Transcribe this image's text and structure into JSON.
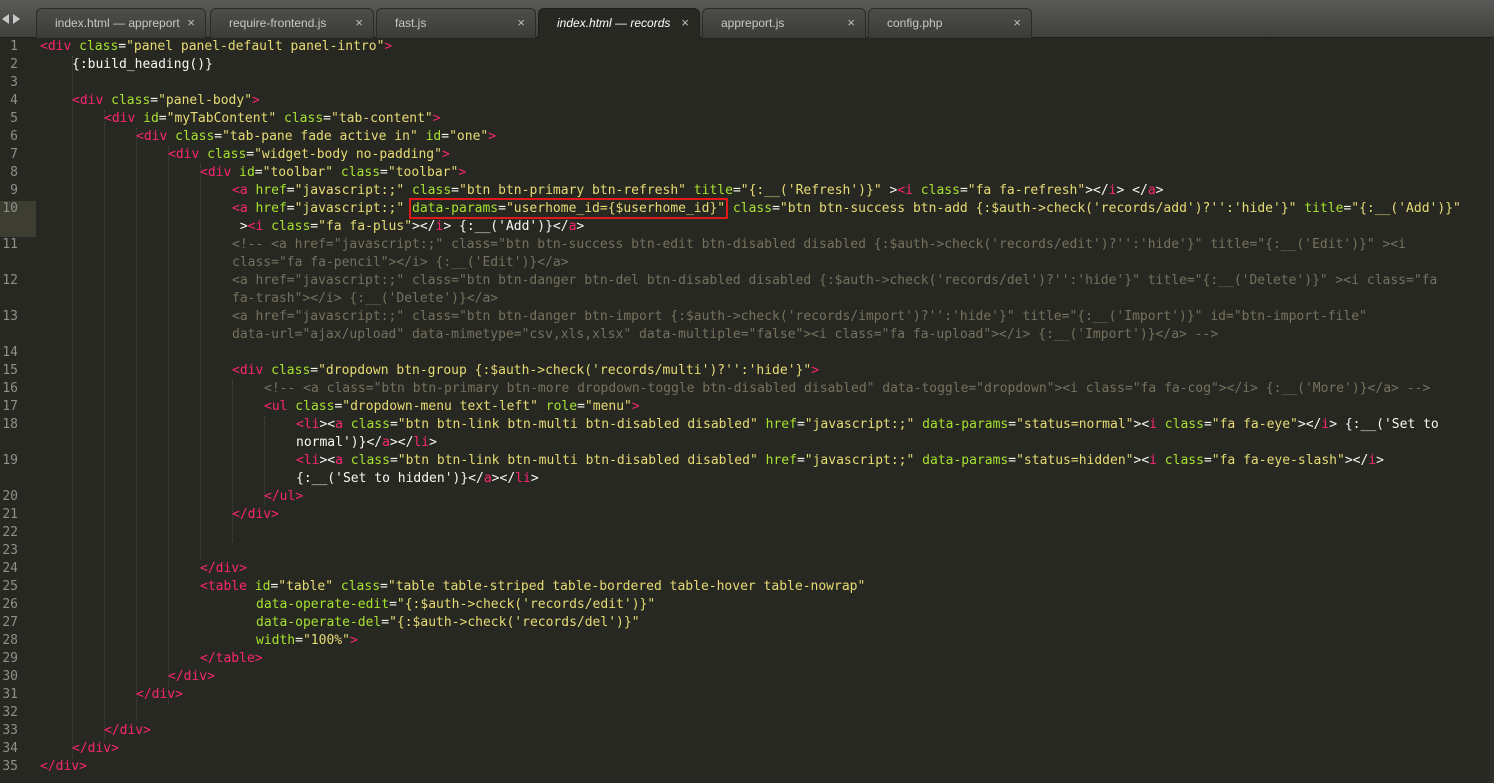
{
  "tabs": [
    {
      "label": "index.html — appreport",
      "active": false
    },
    {
      "label": "require-frontend.js",
      "active": false
    },
    {
      "label": "fast.js",
      "active": false
    },
    {
      "label": "index.html — records",
      "active": true
    },
    {
      "label": "appreport.js",
      "active": false
    },
    {
      "label": "config.php",
      "active": false
    }
  ],
  "tab_close_symbol": "×",
  "colors": {
    "background": "#272822",
    "tag": "#f92672",
    "attribute": "#a6e22e",
    "string": "#e6db74",
    "comment": "#75715e",
    "text": "#f8f8f2",
    "line_number": "#8f908a",
    "highlight_box": "#e0191b"
  },
  "highlighted_line": 10,
  "highlight_box_text": "data-params=\"userhome_id={$userhome_id}\"",
  "line_numbers": [
    "1",
    "2",
    "3",
    "4",
    "5",
    "6",
    "7",
    "8",
    "9",
    "10",
    "11",
    "12",
    "13",
    "14",
    "15",
    "16",
    "17",
    "18",
    "19",
    "20",
    "21",
    "22",
    "23",
    "24",
    "25",
    "26",
    "27",
    "28",
    "29",
    "30",
    "31",
    "32",
    "33",
    "34",
    "35"
  ],
  "code": {
    "l1": {
      "t1": "<div",
      "a1": " class",
      "p1": "=",
      "s1": "\"panel panel-default panel-intro\"",
      "t2": ">"
    },
    "l2": {
      "p1": "{:build_heading()}"
    },
    "l4": {
      "t1": "<div",
      "a1": " class",
      "p1": "=",
      "s1": "\"panel-body\"",
      "t2": ">"
    },
    "l5": {
      "t1": "<div",
      "a1": " id",
      "p1": "=",
      "s1": "\"myTabContent\"",
      "a2": " class",
      "p2": "=",
      "s2": "\"tab-content\"",
      "t2": ">"
    },
    "l6": {
      "t1": "<div",
      "a1": " class",
      "p1": "=",
      "s1": "\"tab-pane fade active in\"",
      "a2": " id",
      "p2": "=",
      "s2": "\"one\"",
      "t2": ">"
    },
    "l7": {
      "t1": "<div",
      "a1": " class",
      "p1": "=",
      "s1": "\"widget-body no-padding\"",
      "t2": ">"
    },
    "l8": {
      "t1": "<div",
      "a1": " id",
      "p1": "=",
      "s1": "\"toolbar\"",
      "a2": " class",
      "p2": "=",
      "s2": "\"toolbar\"",
      "t2": ">"
    },
    "l9": {
      "t1": "<a",
      "a1": " href",
      "p1": "=",
      "s1": "\"javascript:;\"",
      "a2": " class",
      "p2": "=",
      "s2": "\"btn btn-primary btn-refresh\"",
      "a3": " title",
      "p3": "=",
      "s3": "\"{:__('Refresh')}\"",
      "p4": " >",
      "t2": "<i",
      "a4": " class",
      "p5": "=",
      "s4": "\"fa fa-refresh\"",
      "p6": "></",
      "t3": "i",
      "p7": "> </",
      "t4": "a",
      "p8": ">"
    },
    "l10a": {
      "t1": "<a",
      "a1": " href",
      "p1": "=",
      "s1": "\"javascript:;\"",
      "sp": " ",
      "a2": "data-params",
      "p2": "=",
      "s2": "\"userhome_id={$userhome_id}\"",
      "a3": " class",
      "p3": "=",
      "s3": "\"btn btn-success btn-add {:$auth->check('records/add')?'':'hide'}\"",
      "a4": " title",
      "p4": "=",
      "s4": "\"{:__('Add')}\""
    },
    "l10b": {
      "p1": " >",
      "t1": "<i",
      "a1": " class",
      "p2": "=",
      "s1": "\"fa fa-plus\"",
      "p3": "></",
      "t2": "i",
      "p4": "> {:__('Add')}</",
      "t3": "a",
      "p5": ">"
    },
    "l11a": "<!-- <a href=\"javascript:;\" class=\"btn btn-success btn-edit btn-disabled disabled {:$auth->check('records/edit')?'':'hide'}\" title=\"{:__('Edit')}\" ><i",
    "l11b": "class=\"fa fa-pencil\"></i> {:__('Edit')}</a>",
    "l12a": "<a href=\"javascript:;\" class=\"btn btn-danger btn-del btn-disabled disabled {:$auth->check('records/del')?'':'hide'}\" title=\"{:__('Delete')}\" ><i class=\"fa",
    "l12b": "fa-trash\"></i> {:__('Delete')}</a>",
    "l13a": "<a href=\"javascript:;\" class=\"btn btn-danger btn-import {:$auth->check('records/import')?'':'hide'}\" title=\"{:__('Import')}\" id=\"btn-import-file\"",
    "l13b": "data-url=\"ajax/upload\" data-mimetype=\"csv,xls,xlsx\" data-multiple=\"false\"><i class=\"fa fa-upload\"></i> {:__('Import')}</a> -->",
    "l15": {
      "t1": "<div",
      "a1": " class",
      "p1": "=",
      "s1": "\"dropdown btn-group {:$auth->check('records/multi')?'':'hide'}\"",
      "t2": ">"
    },
    "l16": "<!-- <a class=\"btn btn-primary btn-more dropdown-toggle btn-disabled disabled\" data-toggle=\"dropdown\"><i class=\"fa fa-cog\"></i> {:__('More')}</a> -->",
    "l17": {
      "t1": "<ul",
      "a1": " class",
      "p1": "=",
      "s1": "\"dropdown-menu text-left\"",
      "a2": " role",
      "p2": "=",
      "s2": "\"menu\"",
      "t2": ">"
    },
    "l18a": {
      "t1": "<li",
      "p1": "><",
      "t2": "a",
      "a1": " class",
      "p2": "=",
      "s1": "\"btn btn-link btn-multi btn-disabled disabled\"",
      "a2": " href",
      "p3": "=",
      "s2": "\"javascript:;\"",
      "a3": " data-params",
      "p4": "=",
      "s3": "\"status=normal\"",
      "p5": "><",
      "t3": "i",
      "a4": " class",
      "p6": "=",
      "s4": "\"fa fa-eye\"",
      "p7": "></",
      "t4": "i",
      "p8": "> {:__('Set to"
    },
    "l18b": {
      "p1": "normal')}</",
      "t1": "a",
      "p2": "></",
      "t2": "li",
      "p3": ">"
    },
    "l19a": {
      "t1": "<li",
      "p1": "><",
      "t2": "a",
      "a1": " class",
      "p2": "=",
      "s1": "\"btn btn-link btn-multi btn-disabled disabled\"",
      "a2": " href",
      "p3": "=",
      "s2": "\"javascript:;\"",
      "a3": " data-params",
      "p4": "=",
      "s3": "\"status=hidden\"",
      "p5": "><",
      "t3": "i",
      "a4": " class",
      "p6": "=",
      "s4": "\"fa fa-eye-slash\"",
      "p7": "></",
      "t4": "i",
      "p8": ">"
    },
    "l19b": {
      "p1": "{:__('Set to hidden')}</",
      "t1": "a",
      "p2": "></",
      "t2": "li",
      "p3": ">"
    },
    "l20": {
      "t1": "</ul",
      "t2": ">"
    },
    "l21": {
      "t1": "</div",
      "t2": ">"
    },
    "l24": {
      "t1": "</div",
      "t2": ">"
    },
    "l25": {
      "t1": "<table",
      "a1": " id",
      "p1": "=",
      "s1": "\"table\"",
      "a2": " class",
      "p2": "=",
      "s2": "\"table table-striped table-bordered table-hover table-nowrap\""
    },
    "l26": {
      "a1": "data-operate-edit",
      "p1": "=",
      "s1": "\"{:$auth->check('records/edit')}\""
    },
    "l27": {
      "a1": "data-operate-del",
      "p1": "=",
      "s1": "\"{:$auth->check('records/del')}\""
    },
    "l28": {
      "a1": "width",
      "p1": "=",
      "s1": "\"100%\"",
      "t1": ">"
    },
    "l29": {
      "t1": "</table",
      "t2": ">"
    },
    "l30": {
      "t1": "</div",
      "t2": ">"
    },
    "l31": {
      "t1": "</div",
      "t2": ">"
    },
    "l33": {
      "t1": "</div",
      "t2": ">"
    },
    "l34": {
      "t1": "</div",
      "t2": ">"
    },
    "l35": {
      "t1": "</div",
      "t2": ">"
    }
  }
}
